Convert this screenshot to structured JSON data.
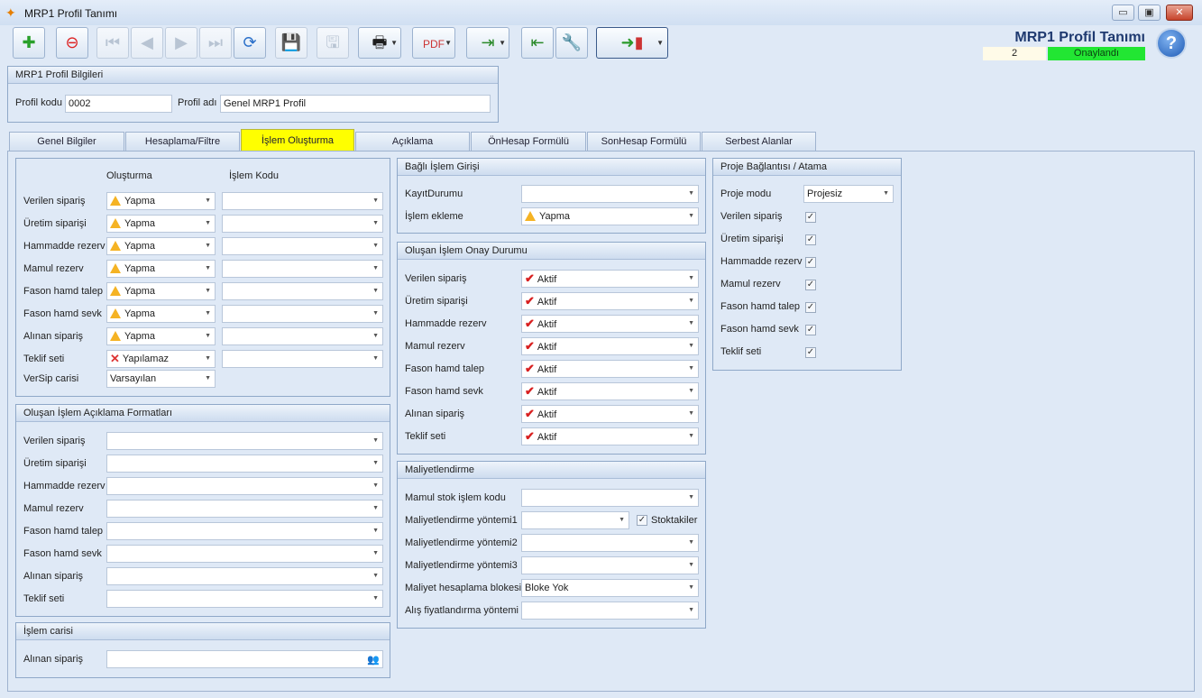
{
  "window": {
    "title": "MRP1 Profil Tanımı",
    "btn_min": "▭",
    "btn_max": "▣",
    "btn_close": "✕",
    "app_icon": "butterfly-icon"
  },
  "toolbar": {
    "icons": [
      "new-doc-icon",
      "delete-doc-icon",
      "first-icon",
      "prev-icon",
      "next-icon",
      "last-icon",
      "refresh-icon",
      "save-icon",
      "save-close-icon",
      "print-icon",
      "pdf-icon",
      "export-icon",
      "import-icon",
      "settings-icon",
      "exit-icon"
    ]
  },
  "header": {
    "title": "MRP1 Profil Tanımı",
    "number": "2",
    "status": "Onaylandı",
    "help": "?"
  },
  "profile": {
    "group_title": "MRP1 Profil Bilgileri",
    "code_label": "Profil kodu",
    "code_value": "0002",
    "name_label": "Profil adı",
    "name_value": "Genel MRP1 Profil"
  },
  "tabs": [
    "Genel Bilgiler",
    "Hesaplama/Filtre",
    "İşlem Oluşturma",
    "Açıklama",
    "ÖnHesap Formülü",
    "SonHesap Formülü",
    "Serbest Alanlar"
  ],
  "olusturma": {
    "col1": "Oluşturma",
    "col2": "İşlem Kodu",
    "rows": [
      {
        "label": "Verilen sipariş",
        "value": "Yapma",
        "icon": "warning"
      },
      {
        "label": "Üretim siparişi",
        "value": "Yapma",
        "icon": "warning"
      },
      {
        "label": "Hammadde rezerv",
        "value": "Yapma",
        "icon": "warning"
      },
      {
        "label": "Mamul rezerv",
        "value": "Yapma",
        "icon": "warning"
      },
      {
        "label": "Fason hamd talep",
        "value": "Yapma",
        "icon": "warning"
      },
      {
        "label": "Fason hamd sevk",
        "value": "Yapma",
        "icon": "warning"
      },
      {
        "label": "Alınan sipariş",
        "value": "Yapma",
        "icon": "warning"
      },
      {
        "label": "Teklif seti",
        "value": "Yapılamaz",
        "icon": "x"
      }
    ],
    "versip_label": "VerSip carisi",
    "versip_value": "Varsayılan"
  },
  "aciklama": {
    "title": "Oluşan İşlem Açıklama Formatları",
    "rows": [
      "Verilen sipariş",
      "Üretim siparişi",
      "Hammadde rezerv",
      "Mamul rezerv",
      "Fason hamd talep",
      "Fason hamd sevk",
      "Alınan sipariş",
      "Teklif seti"
    ]
  },
  "islem_carisi": {
    "title": "İşlem carisi",
    "label": "Alınan sipariş",
    "icon": "people-icon"
  },
  "bagli": {
    "title": "Bağlı İşlem Girişi",
    "kayit_label": "KayıtDurumu",
    "ekleme_label": "İşlem ekleme",
    "ekleme_value": "Yapma"
  },
  "onay": {
    "title": "Oluşan İşlem Onay Durumu",
    "rows": [
      {
        "label": "Verilen sipariş",
        "value": "Aktif"
      },
      {
        "label": "Üretim siparişi",
        "value": "Aktif"
      },
      {
        "label": "Hammadde rezerv",
        "value": "Aktif"
      },
      {
        "label": "Mamul rezerv",
        "value": "Aktif"
      },
      {
        "label": "Fason hamd talep",
        "value": "Aktif"
      },
      {
        "label": "Fason hamd sevk",
        "value": "Aktif"
      },
      {
        "label": "Alınan sipariş",
        "value": "Aktif"
      },
      {
        "label": "Teklif seti",
        "value": "Aktif"
      }
    ]
  },
  "maliyet": {
    "title": "Maliyetlendirme",
    "mamul_stok": "Mamul stok işlem kodu",
    "yontem1": "Maliyetlendirme yöntemi1",
    "stoktakiler": "Stoktakiler",
    "yontem2": "Maliyetlendirme yöntemi2",
    "yontem3": "Maliyetlendirme yöntemi3",
    "blok_label": "Maliyet hesaplama blokesi",
    "blok_value": "Bloke Yok",
    "alis": "Alış fiyatlandırma yöntemi"
  },
  "proje": {
    "title": "Proje Bağlantısı / Atama",
    "mod_label": "Proje modu",
    "mod_value": "Projesiz",
    "rows": [
      "Verilen sipariş",
      "Üretim siparişi",
      "Hammadde rezerv",
      "Mamul rezerv",
      "Fason hamd talep",
      "Fason hamd sevk",
      "Teklif seti"
    ]
  }
}
